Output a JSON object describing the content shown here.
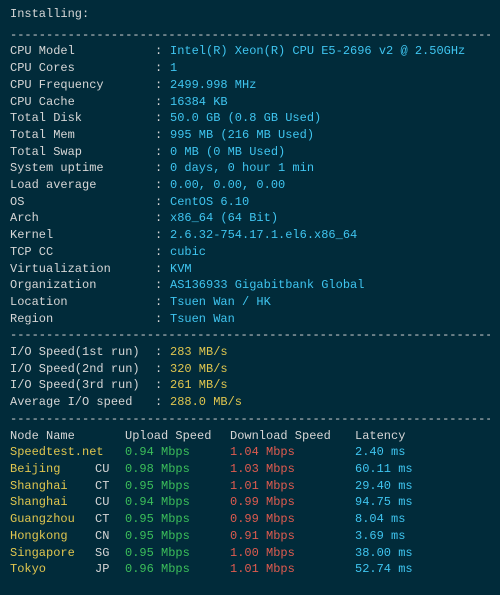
{
  "header": "Installing:",
  "rule": "----------------------------------------------------------------------",
  "specs": [
    {
      "label": "CPU Model",
      "value": "Intel(R) Xeon(R) CPU E5-2696 v2 @ 2.50GHz"
    },
    {
      "label": "CPU Cores",
      "value": "1"
    },
    {
      "label": "CPU Frequency",
      "value": "2499.998 MHz"
    },
    {
      "label": "CPU Cache",
      "value": "16384 KB"
    },
    {
      "label": "Total Disk",
      "value": "50.0 GB (0.8 GB Used)"
    },
    {
      "label": "Total Mem",
      "value": "995 MB (216 MB Used)"
    },
    {
      "label": "Total Swap",
      "value": "0 MB (0 MB Used)"
    },
    {
      "label": "System uptime",
      "value": "0 days, 0 hour 1 min"
    },
    {
      "label": "Load average",
      "value": "0.00, 0.00, 0.00"
    },
    {
      "label": "OS",
      "value": "CentOS 6.10"
    },
    {
      "label": "Arch",
      "value": "x86_64 (64 Bit)"
    },
    {
      "label": "Kernel",
      "value": "2.6.32-754.17.1.el6.x86_64"
    },
    {
      "label": "TCP CC",
      "value": "cubic"
    },
    {
      "label": "Virtualization",
      "value": "KVM"
    },
    {
      "label": "Organization",
      "value": "AS136933 Gigabitbank Global"
    },
    {
      "label": "Location",
      "value": "Tsuen Wan / HK"
    },
    {
      "label": "Region",
      "value": "Tsuen Wan"
    }
  ],
  "io": [
    {
      "label": "I/O Speed(1st run)",
      "value": "283 MB/s"
    },
    {
      "label": "I/O Speed(2nd run)",
      "value": "320 MB/s"
    },
    {
      "label": "I/O Speed(3rd run)",
      "value": "261 MB/s"
    },
    {
      "label": "Average I/O speed",
      "value": "288.0 MB/s"
    }
  ],
  "net_headers": {
    "node": "Node Name",
    "upload": "Upload Speed",
    "download": "Download Speed",
    "latency": "Latency"
  },
  "net": [
    {
      "node": "Speedtest.net",
      "loc": "",
      "up": "0.94 Mbps",
      "down": "1.04 Mbps",
      "lat": "2.40 ms"
    },
    {
      "node": "Beijing",
      "loc": "CU",
      "up": "0.98 Mbps",
      "down": "1.03 Mbps",
      "lat": "60.11 ms"
    },
    {
      "node": "Shanghai",
      "loc": "CT",
      "up": "0.95 Mbps",
      "down": "1.01 Mbps",
      "lat": "29.40 ms"
    },
    {
      "node": "Shanghai",
      "loc": "CU",
      "up": "0.94 Mbps",
      "down": "0.99 Mbps",
      "lat": "94.75 ms"
    },
    {
      "node": "Guangzhou",
      "loc": "CT",
      "up": "0.95 Mbps",
      "down": "0.99 Mbps",
      "lat": "8.04 ms"
    },
    {
      "node": "Hongkong",
      "loc": "CN",
      "up": "0.95 Mbps",
      "down": "0.91 Mbps",
      "lat": "3.69 ms"
    },
    {
      "node": "Singapore",
      "loc": "SG",
      "up": "0.95 Mbps",
      "down": "1.00 Mbps",
      "lat": "38.00 ms"
    },
    {
      "node": "Tokyo",
      "loc": "JP",
      "up": "0.96 Mbps",
      "down": "1.01 Mbps",
      "lat": "52.74 ms"
    }
  ]
}
